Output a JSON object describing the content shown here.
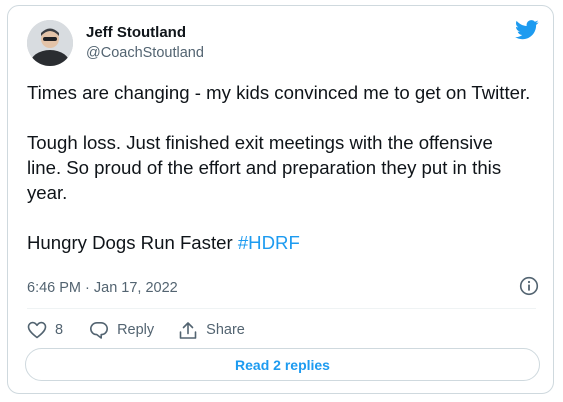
{
  "author": {
    "name": "Jeff Stoutland",
    "handle": "@CoachStoutland"
  },
  "icons": {
    "brand": "twitter-bird-icon",
    "info": "info-icon",
    "like": "heart-icon",
    "reply": "reply-icon",
    "share": "share-icon"
  },
  "tweet": {
    "paragraph1": "Times are changing - my kids convinced me to get on Twitter.",
    "paragraph2": "Tough loss. Just finished exit meetings with the offensive line. So proud of the effort and preparation they put in this year.",
    "paragraph3_text": "Hungry Dogs Run Faster ",
    "hashtag": "#HDRF",
    "timestamp": "6:46 PM · Jan 17, 2022"
  },
  "actions": {
    "like_count": "8",
    "reply_label": "Reply",
    "share_label": "Share"
  },
  "read_replies_label": "Read 2 replies",
  "colors": {
    "accent": "#1d9bf0",
    "text": "#0f1419",
    "secondary": "#536471",
    "border": "#cfd9de"
  }
}
